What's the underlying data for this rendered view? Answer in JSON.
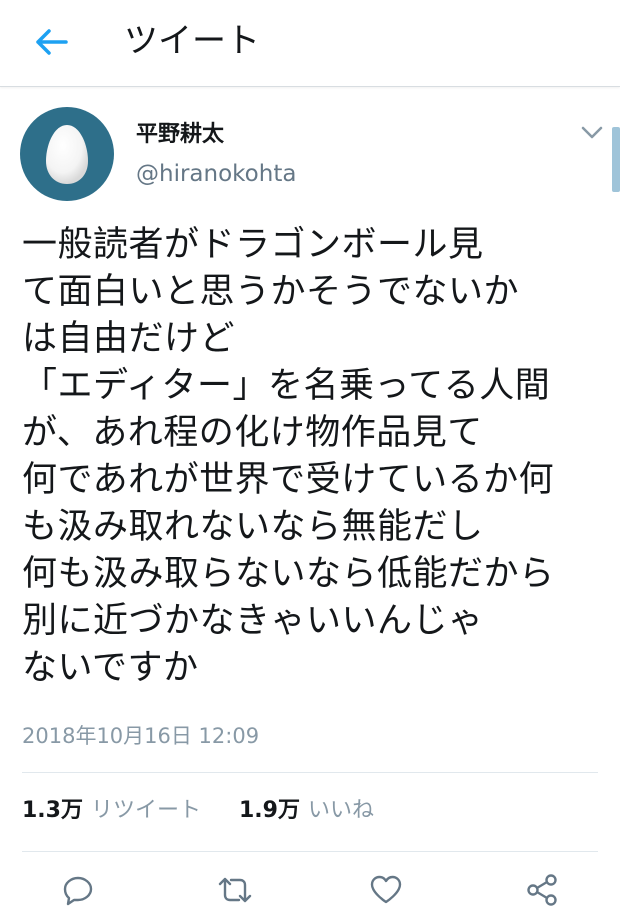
{
  "header": {
    "title": "ツイート",
    "back_icon": "arrow-left-icon",
    "accent": "#1da1f2"
  },
  "tweet": {
    "author": {
      "display_name": "平野耕太",
      "handle": "@hiranokohta",
      "avatar_icon": "egg-avatar-icon",
      "avatar_color": "#2e6f8a"
    },
    "lines": [
      "一般読者がドラゴンボール見",
      "て面白いと思うかそうでないか",
      "は自由だけど",
      "「エディター」を名乗ってる人間",
      "が、あれ程の化け物作品見て",
      "何であれが世界で受けているか何",
      "も汲み取れないなら無能だし",
      "何も汲み取らないなら低能だから",
      "別に近づかなきゃいいんじゃ",
      "ないですか"
    ],
    "timestamp": "2018年10月16日 12:09",
    "stats": {
      "retweets_count": "1.3万",
      "retweets_label": "リツイート",
      "likes_count": "1.9万",
      "likes_label": "いいね"
    }
  },
  "actions": {
    "reply_icon": "reply-icon",
    "retweet_icon": "retweet-icon",
    "like_icon": "heart-icon",
    "share_icon": "share-icon",
    "icon_color": "#657786"
  }
}
